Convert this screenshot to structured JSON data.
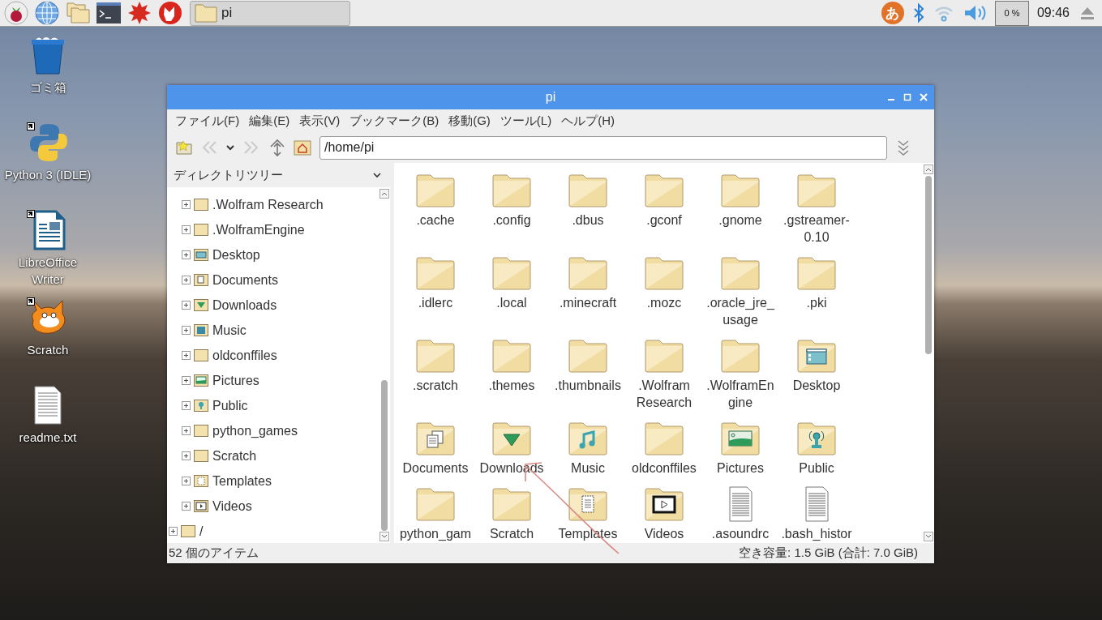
{
  "taskbar": {
    "task_button": {
      "label": "pi"
    },
    "ime_indicator": "あ",
    "cpu_usage": "0 %",
    "clock": "09:46"
  },
  "desktop_icons": [
    {
      "label": "ゴミ箱",
      "kind": "trash",
      "shortcut": false
    },
    {
      "label": "Python 3 (IDLE)",
      "kind": "python",
      "shortcut": true
    },
    {
      "label": "LibreOffice Writer",
      "kind": "writer",
      "shortcut": true
    },
    {
      "label": "Scratch",
      "kind": "scratch",
      "shortcut": true
    },
    {
      "label": "readme.txt",
      "kind": "text",
      "shortcut": false
    }
  ],
  "window": {
    "title": "pi",
    "menu": [
      "ファイル(F)",
      "編集(E)",
      "表示(V)",
      "ブックマーク(B)",
      "移動(G)",
      "ツール(L)",
      "ヘルプ(H)"
    ],
    "toolbar": {
      "back_disabled": true,
      "forward_disabled": true
    },
    "path": "/home/pi",
    "sidebar": {
      "header": "ディレクトリツリー",
      "tree": [
        {
          "children": [
            {
              "label": ".Wolfram Research",
              "kind": "folder",
              "expanded": false
            },
            {
              "label": ".WolframEngine",
              "kind": "folder",
              "expanded": false
            },
            {
              "label": "Desktop",
              "kind": "desktop",
              "expanded": false
            },
            {
              "label": "Documents",
              "kind": "documents",
              "expanded": false
            },
            {
              "label": "Downloads",
              "kind": "downloads",
              "expanded": false
            },
            {
              "label": "Music",
              "kind": "music",
              "expanded": false
            },
            {
              "label": "oldconffiles",
              "kind": "folder",
              "expanded": false
            },
            {
              "label": "Pictures",
              "kind": "pictures",
              "expanded": false
            },
            {
              "label": "Public",
              "kind": "public",
              "expanded": false
            },
            {
              "label": "python_games",
              "kind": "folder",
              "expanded": false
            },
            {
              "label": "Scratch",
              "kind": "folder",
              "expanded": false
            },
            {
              "label": "Templates",
              "kind": "templates",
              "expanded": false
            },
            {
              "label": "Videos",
              "kind": "videos",
              "expanded": false
            }
          ]
        },
        {
          "label": "/",
          "kind": "folder",
          "expanded": false
        }
      ]
    },
    "files": [
      {
        "label": ".cache",
        "kind": "folder"
      },
      {
        "label": ".config",
        "kind": "folder"
      },
      {
        "label": ".dbus",
        "kind": "folder"
      },
      {
        "label": ".gconf",
        "kind": "folder"
      },
      {
        "label": ".gnome",
        "kind": "folder"
      },
      {
        "label": ".gstreamer-0.10",
        "kind": "folder"
      },
      {
        "label": ".idlerc",
        "kind": "folder"
      },
      {
        "label": ".local",
        "kind": "folder"
      },
      {
        "label": ".minecraft",
        "kind": "folder"
      },
      {
        "label": ".mozc",
        "kind": "folder"
      },
      {
        "label": ".oracle_jre_usage",
        "kind": "folder"
      },
      {
        "label": ".pki",
        "kind": "folder"
      },
      {
        "label": ".scratch",
        "kind": "folder"
      },
      {
        "label": ".themes",
        "kind": "folder"
      },
      {
        "label": ".thumbnails",
        "kind": "folder"
      },
      {
        "label": ".Wolfram Research",
        "kind": "folder"
      },
      {
        "label": ".WolframEngine",
        "kind": "folder"
      },
      {
        "label": "Desktop",
        "kind": "desktop"
      },
      {
        "label": "Documents",
        "kind": "documents"
      },
      {
        "label": "Downloads",
        "kind": "downloads"
      },
      {
        "label": "Music",
        "kind": "music"
      },
      {
        "label": "oldconffiles",
        "kind": "folder"
      },
      {
        "label": "Pictures",
        "kind": "pictures"
      },
      {
        "label": "Public",
        "kind": "public"
      },
      {
        "label": "python_gam",
        "kind": "folder"
      },
      {
        "label": "Scratch",
        "kind": "folder"
      },
      {
        "label": "Templates",
        "kind": "templates"
      },
      {
        "label": "Videos",
        "kind": "videos"
      },
      {
        "label": ".asoundrc",
        "kind": "text"
      },
      {
        "label": ".bash_histor",
        "kind": "text"
      }
    ],
    "status_bar": {
      "item_count": "52 個のアイテム",
      "free_space": "空き容量: 1.5 GiB (合計: 7.0 GiB)"
    }
  }
}
